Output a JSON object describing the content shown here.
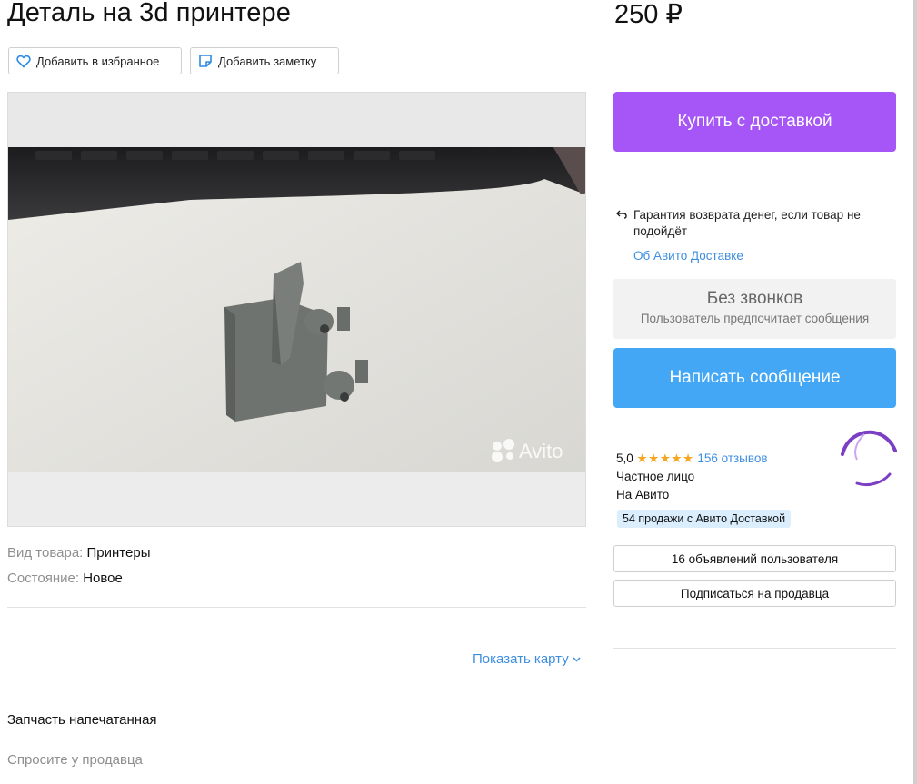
{
  "title": "Деталь на 3d принтере",
  "price": "250 ₽",
  "actions": {
    "favorite_label": "Добавить в избранное",
    "note_label": "Добавить заметку"
  },
  "photo": {
    "watermark": "Avito"
  },
  "specs": [
    {
      "label": "Вид товара:",
      "value": "Принтеры"
    },
    {
      "label": "Состояние:",
      "value": "Новое"
    }
  ],
  "show_map_label": "Показать карту",
  "description": "Запчасть напечатанная",
  "ask_seller": "Спросите у продавца",
  "sidebar": {
    "buy_label": "Купить с доставкой",
    "guarantee_text": "Гарантия возврата денег, если товар не подойдёт",
    "about_delivery": "Об Авито Доставке",
    "no_calls_title": "Без звонков",
    "no_calls_subtitle": "Пользователь предпочитает сообщения",
    "message_label": "Написать сообщение",
    "rating": "5,0",
    "stars": "★★★★★",
    "reviews_label": "156 отзывов",
    "seller_type": "Частное лицо",
    "on_avito": "На Авито",
    "delivery_badge": "54 продажи с Авито Доставкой",
    "listings_label": "16 объявлений пользователя",
    "subscribe_label": "Подписаться на продавца"
  },
  "colors": {
    "buy_button": "#a655f7",
    "message_button": "#44a7f5",
    "link": "#3e8ee0",
    "star": "#f5a623",
    "badge_bg": "#daeefe"
  }
}
